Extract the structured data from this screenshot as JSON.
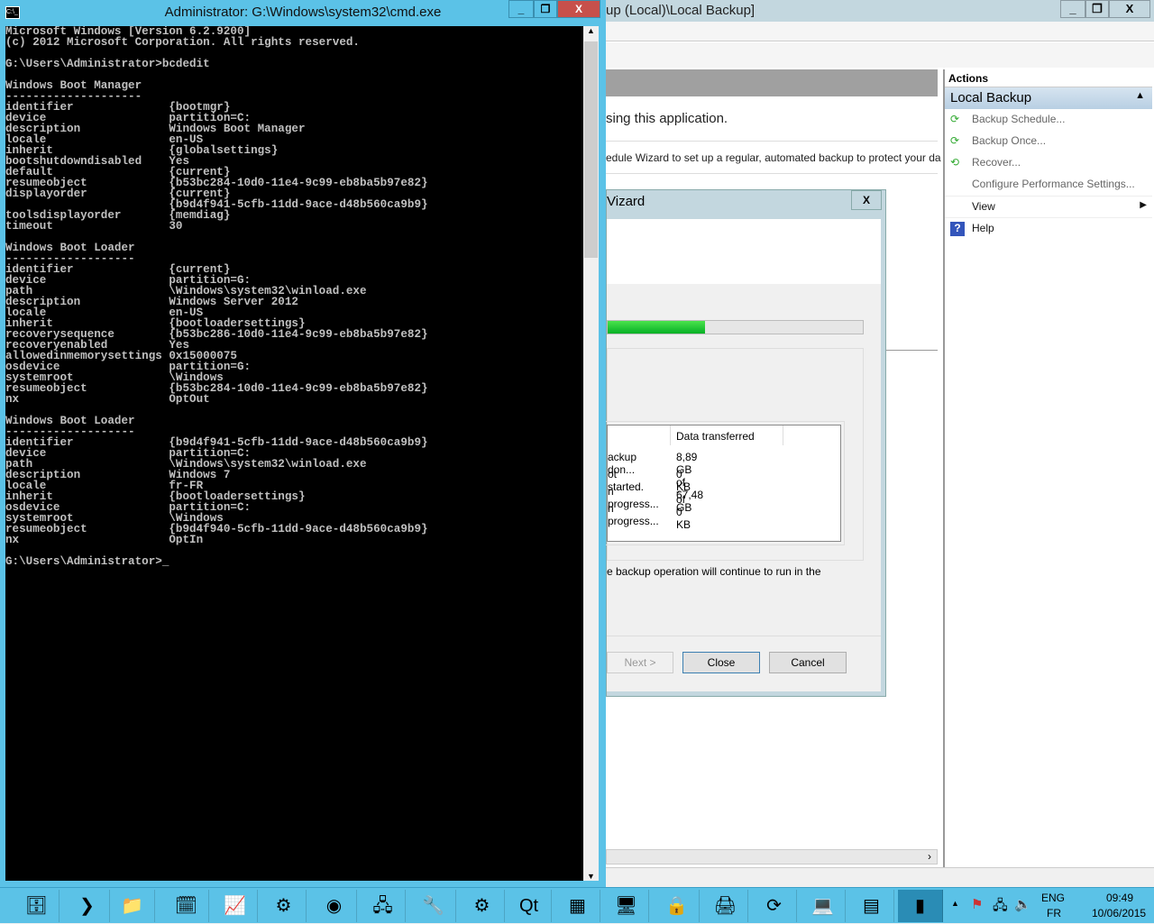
{
  "backup_window": {
    "title": "up (Local)\\Local Backup]",
    "message": "sing this application.",
    "hint": "edule Wizard to set up a regular, automated backup to protect your da",
    "actions": {
      "header": "Actions",
      "section": "Local Backup",
      "items": [
        {
          "label": "Backup Schedule...",
          "icon": "backup-schedule-icon"
        },
        {
          "label": "Backup Once...",
          "icon": "backup-once-icon"
        },
        {
          "label": "Recover...",
          "icon": "recover-icon"
        },
        {
          "label": "Configure Performance Settings...",
          "icon": ""
        },
        {
          "label": "View",
          "icon": ""
        },
        {
          "label": "Help",
          "icon": "help-icon"
        }
      ]
    }
  },
  "wizard": {
    "title": "Vizard",
    "progress_percent": 38,
    "table": {
      "headers": [
        "",
        "Data transferred"
      ],
      "rows": [
        [
          "ackup don...",
          "8,89 GB of 67,48 GB"
        ],
        [
          "ot started.",
          "0 KB of 0 KB"
        ],
        [
          "n progress...",
          "-"
        ],
        [
          "n progress...",
          "-"
        ]
      ]
    },
    "note": "e backup operation will continue to run in the",
    "buttons": {
      "next": "Next >",
      "close": "Close",
      "cancel": "Cancel"
    },
    "accent": "#06b025"
  },
  "cmd": {
    "title": "Administrator: G:\\Windows\\system32\\cmd.exe",
    "icon_text": "C:\\_",
    "lines": [
      "Microsoft Windows [Version 6.2.9200]",
      "(c) 2012 Microsoft Corporation. All rights reserved.",
      "",
      "G:\\Users\\Administrator>bcdedit",
      "",
      "Windows Boot Manager",
      "--------------------",
      "identifier              {bootmgr}",
      "device                  partition=C:",
      "description             Windows Boot Manager",
      "locale                  en-US",
      "inherit                 {globalsettings}",
      "bootshutdowndisabled    Yes",
      "default                 {current}",
      "resumeobject            {b53bc284-10d0-11e4-9c99-eb8ba5b97e82}",
      "displayorder            {current}",
      "                        {b9d4f941-5cfb-11dd-9ace-d48b560ca9b9}",
      "toolsdisplayorder       {memdiag}",
      "timeout                 30",
      "",
      "Windows Boot Loader",
      "-------------------",
      "identifier              {current}",
      "device                  partition=G:",
      "path                    \\Windows\\system32\\winload.exe",
      "description             Windows Server 2012",
      "locale                  en-US",
      "inherit                 {bootloadersettings}",
      "recoverysequence        {b53bc286-10d0-11e4-9c99-eb8ba5b97e82}",
      "recoveryenabled         Yes",
      "allowedinmemorysettings 0x15000075",
      "osdevice                partition=G:",
      "systemroot              \\Windows",
      "resumeobject            {b53bc284-10d0-11e4-9c99-eb8ba5b97e82}",
      "nx                      OptOut",
      "",
      "Windows Boot Loader",
      "-------------------",
      "identifier              {b9d4f941-5cfb-11dd-9ace-d48b560ca9b9}",
      "device                  partition=C:",
      "path                    \\Windows\\system32\\winload.exe",
      "description             Windows 7",
      "locale                  fr-FR",
      "inherit                 {bootloadersettings}",
      "osdevice                partition=C:",
      "systemroot              \\Windows",
      "resumeobject            {b9d4f940-5cfb-11dd-9ace-d48b560ca9b9}",
      "nx                      OptIn",
      "",
      "G:\\Users\\Administrator>_"
    ]
  },
  "taskbar": {
    "apps": [
      "server-manager",
      "powershell",
      "file-explorer",
      "task-scheduler",
      "performance-monitor",
      "control-panel",
      "chrome",
      "network",
      "tools",
      "services",
      "qt-creator",
      "registry",
      "remote-desktop",
      "security",
      "printer",
      "backup",
      "computer",
      "event-viewer",
      "cmd"
    ],
    "tray": {
      "lang_top": "ENG",
      "lang_bottom": "FR",
      "time": "09:49",
      "date": "10/06/2015"
    }
  }
}
